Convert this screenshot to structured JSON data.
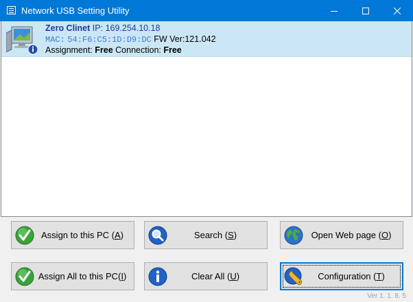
{
  "window": {
    "title": "Network USB Setting Utility"
  },
  "device": {
    "name": "Zero Clinet",
    "ip_label": "IP:",
    "ip": "169.254.10.18",
    "mac_label": "MAC:",
    "mac": "54:F6:C5:1D:D9:DC",
    "fw_label": "FW Ver:",
    "fw": "121.042",
    "assignment_label": "Assignment:",
    "assignment": "Free",
    "connection_label": "Connection:",
    "connection": "Free"
  },
  "buttons": {
    "assign_pc": {
      "pre": "Assign to this PC (",
      "key": "A",
      "post": ")"
    },
    "search": {
      "pre": "Search (",
      "key": "S",
      "post": ")"
    },
    "open_web": {
      "pre": "Open Web page (",
      "key": "O",
      "post": ")"
    },
    "assign_all": {
      "pre": "Assign All  to this PC(",
      "key": "I",
      "post": ")"
    },
    "clear_all": {
      "pre": "Clear All (",
      "key": "U",
      "post": ")"
    },
    "configuration": {
      "pre": "Configuration (",
      "key": "T",
      "post": ")"
    }
  },
  "version": "Ver 1. 1. 8. 5",
  "icons": {
    "app": "window-icon",
    "device": "computer-info-icon",
    "assign": "green-check-icon",
    "search": "magnifier-icon",
    "web": "globe-icon",
    "clear": "info-icon",
    "config": "wrench-icon"
  },
  "colors": {
    "titlebar": "#0078d7",
    "selection": "#cbe6f5",
    "name": "#1a3a9e",
    "mac": "#3d7dd0"
  }
}
